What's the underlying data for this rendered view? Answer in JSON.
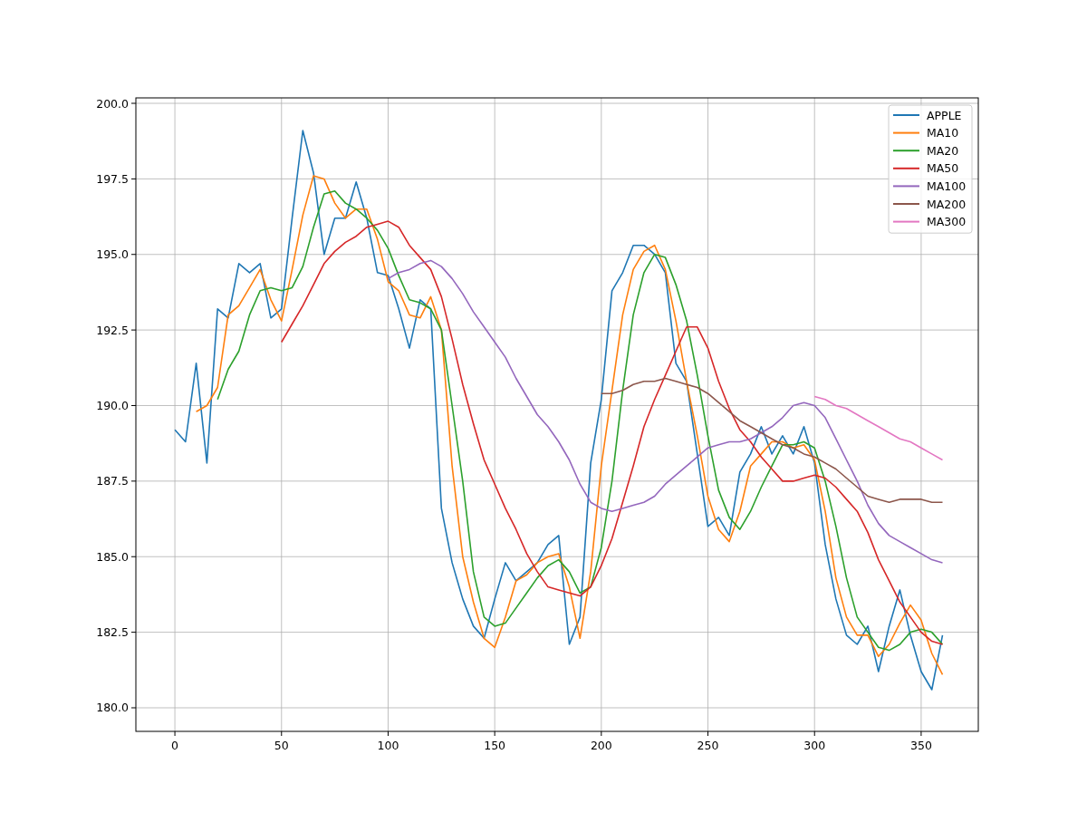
{
  "chart_data": {
    "type": "line",
    "grid": true,
    "legend": true,
    "xlim": [
      -18.3,
      376.8
    ],
    "ylim": [
      179.22,
      200.18
    ],
    "xticks": [
      0,
      50,
      100,
      150,
      200,
      250,
      300,
      350
    ],
    "yticks": [
      {
        "value": 180,
        "label": "180.0"
      },
      {
        "value": 182.5,
        "label": "182.5"
      },
      {
        "value": 185,
        "label": "185.0"
      },
      {
        "value": 187.5,
        "label": "187.5"
      },
      {
        "value": 190,
        "label": "190.0"
      },
      {
        "value": 192.5,
        "label": "192.5"
      },
      {
        "value": 195,
        "label": "195.0"
      },
      {
        "value": 197.5,
        "label": "197.5"
      },
      {
        "value": 200,
        "label": "200.0"
      }
    ],
    "x": [
      0,
      5,
      10,
      15,
      20,
      25,
      30,
      35,
      40,
      45,
      50,
      55,
      60,
      65,
      70,
      75,
      80,
      85,
      90,
      95,
      100,
      105,
      110,
      115,
      120,
      125,
      130,
      135,
      140,
      145,
      150,
      155,
      160,
      165,
      170,
      175,
      180,
      185,
      190,
      195,
      200,
      205,
      210,
      215,
      220,
      225,
      230,
      235,
      240,
      245,
      250,
      255,
      260,
      265,
      270,
      275,
      280,
      285,
      290,
      295,
      300,
      305,
      310,
      315,
      320,
      325,
      330,
      335,
      340,
      345,
      350,
      355,
      360
    ],
    "series": [
      {
        "name": "APPLE",
        "color": "#1f77b4",
        "values": [
          189.2,
          188.8,
          191.4,
          188.1,
          193.2,
          192.9,
          194.7,
          194.4,
          194.7,
          192.9,
          193.2,
          196.2,
          199.1,
          197.7,
          195.0,
          196.2,
          196.2,
          197.4,
          196.2,
          194.4,
          194.3,
          193.2,
          191.9,
          193.5,
          193.2,
          186.6,
          184.8,
          183.6,
          182.7,
          182.3,
          183.6,
          184.8,
          184.2,
          184.5,
          184.8,
          185.4,
          185.7,
          182.1,
          183.0,
          188.1,
          190.2,
          193.8,
          194.4,
          195.3,
          195.3,
          195.0,
          194.4,
          191.4,
          190.8,
          188.4,
          186.0,
          186.3,
          185.7,
          187.8,
          188.4,
          189.3,
          188.4,
          189.0,
          188.4,
          189.3,
          188.1,
          185.4,
          183.6,
          182.4,
          182.1,
          182.7,
          181.2,
          182.7,
          183.9,
          182.4,
          181.2,
          180.6,
          182.4
        ]
      },
      {
        "name": "MA10",
        "color": "#ff7f0e",
        "values": [
          null,
          null,
          189.8,
          190.0,
          190.6,
          193.0,
          193.3,
          193.9,
          194.5,
          193.5,
          192.8,
          194.5,
          196.3,
          197.6,
          197.5,
          196.7,
          196.2,
          196.5,
          196.5,
          195.5,
          194.1,
          193.8,
          193.0,
          192.9,
          193.6,
          192.5,
          188.0,
          185.0,
          183.5,
          182.3,
          182.0,
          183.0,
          184.2,
          184.4,
          184.8,
          185.0,
          185.1,
          184.0,
          182.3,
          184.5,
          188.0,
          190.5,
          193.0,
          194.5,
          195.1,
          195.3,
          194.5,
          192.8,
          190.8,
          189.0,
          187.0,
          185.9,
          185.5,
          186.5,
          188.0,
          188.4,
          188.8,
          188.8,
          188.6,
          188.7,
          188.2,
          186.5,
          184.3,
          183.0,
          182.4,
          182.4,
          181.7,
          182.1,
          182.8,
          183.4,
          182.9,
          181.8,
          181.1
        ]
      },
      {
        "name": "MA20",
        "color": "#2ca02c",
        "values": [
          null,
          null,
          null,
          null,
          190.2,
          191.2,
          191.8,
          193.0,
          193.8,
          193.9,
          193.8,
          193.9,
          194.6,
          195.9,
          197.0,
          197.1,
          196.7,
          196.5,
          196.2,
          195.8,
          195.2,
          194.3,
          193.5,
          193.4,
          193.2,
          192.5,
          190.0,
          187.5,
          184.5,
          183.0,
          182.7,
          182.8,
          183.3,
          183.8,
          184.3,
          184.7,
          184.9,
          184.5,
          183.8,
          184.0,
          185.3,
          187.5,
          190.5,
          193.0,
          194.4,
          195.0,
          194.9,
          194.0,
          192.8,
          191.0,
          189.0,
          187.2,
          186.3,
          185.9,
          186.5,
          187.3,
          188.0,
          188.7,
          188.7,
          188.8,
          188.6,
          187.5,
          186.0,
          184.3,
          183.0,
          182.5,
          182.0,
          181.9,
          182.1,
          182.5,
          182.6,
          182.5,
          182.1
        ]
      },
      {
        "name": "MA50",
        "color": "#d62728",
        "values": [
          null,
          null,
          null,
          null,
          null,
          null,
          null,
          null,
          null,
          null,
          192.1,
          192.7,
          193.3,
          194.0,
          194.7,
          195.1,
          195.4,
          195.6,
          195.9,
          196.0,
          196.1,
          195.9,
          195.3,
          194.9,
          194.5,
          193.6,
          192.2,
          190.7,
          189.4,
          188.2,
          187.4,
          186.6,
          185.9,
          185.1,
          184.5,
          184.0,
          183.9,
          183.8,
          183.7,
          184.0,
          184.7,
          185.6,
          186.8,
          188.0,
          189.3,
          190.2,
          191.0,
          191.8,
          192.6,
          192.6,
          191.9,
          190.8,
          189.9,
          189.2,
          188.8,
          188.3,
          187.9,
          187.5,
          187.5,
          187.6,
          187.7,
          187.6,
          187.3,
          186.9,
          186.5,
          185.8,
          184.9,
          184.2,
          183.5,
          183.0,
          182.5,
          182.2,
          182.1
        ]
      },
      {
        "name": "MA100",
        "color": "#9467bd",
        "values": [
          null,
          null,
          null,
          null,
          null,
          null,
          null,
          null,
          null,
          null,
          null,
          null,
          null,
          null,
          null,
          null,
          null,
          null,
          null,
          null,
          194.2,
          194.4,
          194.5,
          194.7,
          194.8,
          194.6,
          194.2,
          193.7,
          193.1,
          192.6,
          192.1,
          191.6,
          190.9,
          190.3,
          189.7,
          189.3,
          188.8,
          188.2,
          187.4,
          186.8,
          186.6,
          186.5,
          186.6,
          186.7,
          186.8,
          187.0,
          187.4,
          187.7,
          188.0,
          188.3,
          188.6,
          188.7,
          188.8,
          188.8,
          188.9,
          189.1,
          189.3,
          189.6,
          190.0,
          190.1,
          190.0,
          189.6,
          188.9,
          188.2,
          187.5,
          186.7,
          186.1,
          185.7,
          185.5,
          185.3,
          185.1,
          184.9,
          184.8
        ]
      },
      {
        "name": "MA200",
        "color": "#8c564b",
        "values": [
          null,
          null,
          null,
          null,
          null,
          null,
          null,
          null,
          null,
          null,
          null,
          null,
          null,
          null,
          null,
          null,
          null,
          null,
          null,
          null,
          null,
          null,
          null,
          null,
          null,
          null,
          null,
          null,
          null,
          null,
          null,
          null,
          null,
          null,
          null,
          null,
          null,
          null,
          null,
          null,
          190.4,
          190.4,
          190.5,
          190.7,
          190.8,
          190.8,
          190.9,
          190.8,
          190.7,
          190.6,
          190.4,
          190.1,
          189.8,
          189.5,
          189.3,
          189.1,
          188.9,
          188.7,
          188.6,
          188.4,
          188.3,
          188.1,
          187.9,
          187.6,
          187.3,
          187.0,
          186.9,
          186.8,
          186.9,
          186.9,
          186.9,
          186.8,
          186.8
        ]
      },
      {
        "name": "MA300",
        "color": "#e377c2",
        "values": [
          null,
          null,
          null,
          null,
          null,
          null,
          null,
          null,
          null,
          null,
          null,
          null,
          null,
          null,
          null,
          null,
          null,
          null,
          null,
          null,
          null,
          null,
          null,
          null,
          null,
          null,
          null,
          null,
          null,
          null,
          null,
          null,
          null,
          null,
          null,
          null,
          null,
          null,
          null,
          null,
          null,
          null,
          null,
          null,
          null,
          null,
          null,
          null,
          null,
          null,
          null,
          null,
          null,
          null,
          null,
          null,
          null,
          null,
          null,
          null,
          190.3,
          190.2,
          190.0,
          189.9,
          189.7,
          189.5,
          189.3,
          189.1,
          188.9,
          188.8,
          188.6,
          188.4,
          188.2
        ]
      }
    ]
  }
}
